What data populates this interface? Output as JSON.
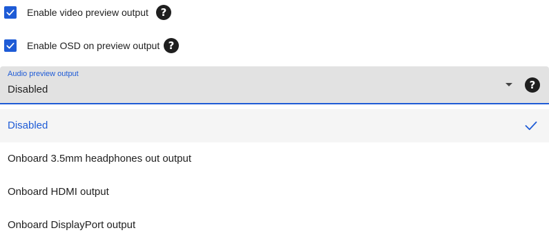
{
  "settings": {
    "video_preview": {
      "label": "Enable video preview output",
      "checked": true,
      "help_icon": "?"
    },
    "osd_preview": {
      "label": "Enable OSD on preview output",
      "checked": true,
      "help_icon": "?"
    },
    "audio_preview": {
      "label": "Audio preview output",
      "value": "Disabled",
      "help_icon": "?",
      "options": [
        {
          "label": "Disabled",
          "selected": true
        },
        {
          "label": "Onboard 3.5mm headphones out output",
          "selected": false
        },
        {
          "label": "Onboard HDMI output",
          "selected": false
        },
        {
          "label": "Onboard DisplayPort output",
          "selected": false
        }
      ]
    }
  },
  "colors": {
    "accent": "#1e5bd6",
    "field_background": "#e2e2e2",
    "selected_row": "#f5f5f5",
    "text": "#212121"
  },
  "icons": {
    "checkbox": "checkmark-icon",
    "help": "help-circle-icon",
    "dropdown": "caret-down-icon",
    "selected": "check-icon"
  }
}
